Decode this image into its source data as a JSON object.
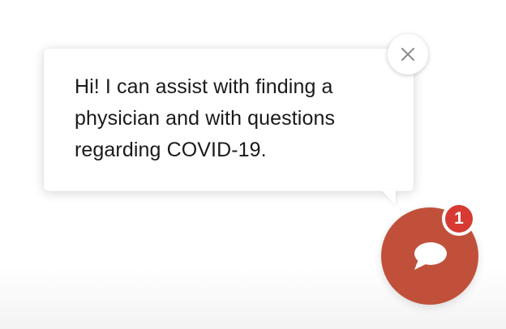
{
  "chat_prompt": {
    "message": "Hi! I can assist with finding a physician and with questions regarding COVID-19.",
    "close_icon": "close-icon"
  },
  "chat_launcher": {
    "icon": "chat-bubble-icon",
    "unread_count": "1"
  },
  "colors": {
    "launcher": "#c1503a",
    "badge": "#d63a33",
    "close_icon": "#8a8a8a"
  }
}
